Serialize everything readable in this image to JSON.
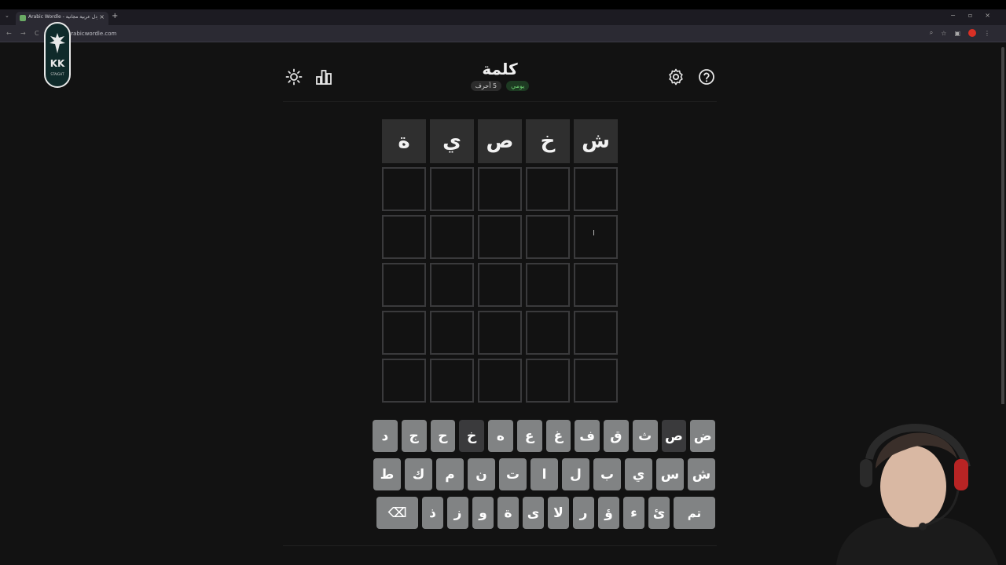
{
  "browser": {
    "tab_title": "Arabic Wordle - لعبة وردل عربية مجانية",
    "tab_close": "×",
    "new_tab": "+",
    "tab_menu": "⌄",
    "url": "arabicwordle.com",
    "nav_back": "←",
    "nav_forward": "→",
    "nav_reload": "C",
    "win_min": "−",
    "win_max": "▫",
    "win_close": "×"
  },
  "logo": {
    "mark": "KK",
    "small": "STAIGHT"
  },
  "header": {
    "title": "كلمة",
    "badge_daily": "يومي",
    "badge_length": "5 أحرف",
    "icons": [
      "theme-icon",
      "stats-icon",
      "settings-icon",
      "help-icon"
    ]
  },
  "board": {
    "rows": [
      [
        "ش",
        "خ",
        "ص",
        "ي",
        "ة"
      ],
      [
        "",
        "",
        "",
        "",
        ""
      ],
      [
        "",
        "",
        "",
        "",
        ""
      ],
      [
        "",
        "",
        "",
        "",
        ""
      ],
      [
        "",
        "",
        "",
        "",
        ""
      ],
      [
        "",
        "",
        "",
        "",
        ""
      ]
    ]
  },
  "keyboard": {
    "row1": [
      "ض",
      "ص",
      "ث",
      "ق",
      "ف",
      "غ",
      "ع",
      "ه",
      "خ",
      "ح",
      "ج",
      "د"
    ],
    "row2": [
      "ش",
      "س",
      "ي",
      "ب",
      "ل",
      "ا",
      "ت",
      "ن",
      "م",
      "ك",
      "ط"
    ],
    "row3": [
      "تم",
      "ئ",
      "ء",
      "ؤ",
      "ر",
      "لا",
      "ى",
      "ة",
      "و",
      "ز",
      "ذ"
    ],
    "dark_keys": [
      "ص",
      "خ"
    ],
    "backspace_icon": "⌫"
  },
  "cursor": "I",
  "colors": {
    "background": "#121212",
    "key": "#818384",
    "key_used": "#3a3a3c",
    "tile_border": "#3a3a3c",
    "badge_green": "#6acb6e"
  }
}
